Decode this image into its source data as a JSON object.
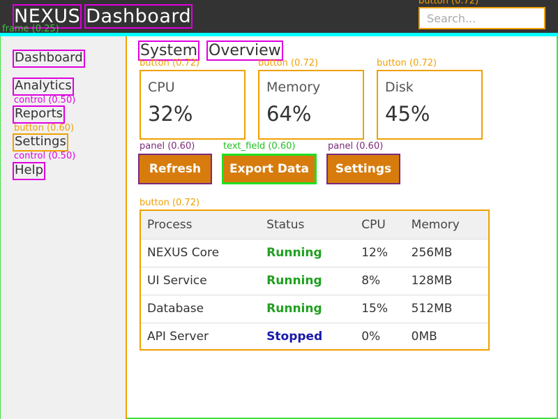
{
  "header": {
    "title_words": [
      "NEXUS",
      "Dashboard"
    ],
    "search_placeholder": "Search..."
  },
  "sidebar": {
    "items": [
      {
        "label": "Dashboard"
      },
      {
        "label": "Analytics"
      },
      {
        "label": "Reports"
      },
      {
        "label": "Settings"
      },
      {
        "label": "Help"
      }
    ]
  },
  "main": {
    "title_words": [
      "System",
      "Overview"
    ],
    "cards": [
      {
        "label": "CPU",
        "value": "32%"
      },
      {
        "label": "Memory",
        "value": "64%"
      },
      {
        "label": "Disk",
        "value": "45%"
      }
    ],
    "actions": {
      "refresh": "Refresh",
      "export": "Export Data",
      "settings": "Settings"
    },
    "table": {
      "headers": [
        "Process",
        "Status",
        "CPU",
        "Memory"
      ],
      "rows": [
        {
          "process": "NEXUS Core",
          "status": "Running",
          "cpu": "12%",
          "memory": "256MB"
        },
        {
          "process": "UI Service",
          "status": "Running",
          "cpu": "8%",
          "memory": "128MB"
        },
        {
          "process": "Database",
          "status": "Running",
          "cpu": "15%",
          "memory": "512MB"
        },
        {
          "process": "API Server",
          "status": "Stopped",
          "cpu": "0%",
          "memory": "0MB"
        }
      ]
    }
  },
  "overlay_labels": {
    "search": "button (0.72)",
    "cards": [
      "button (0.72)",
      "button (0.72)",
      "button (0.72)"
    ],
    "actions": [
      "panel (0.60)",
      "text_field (0.60)",
      "panel (0.60)"
    ],
    "table": "button (0.72)",
    "nav_settings": "button (0.60)",
    "nav_reports": "control (0.50)",
    "nav_help": "control (0.50)",
    "sidebar_frame": "frame (0.25)"
  },
  "colors": {
    "header_bg": "#333333",
    "accent": "#00ffff",
    "button_bg": "#d77c0c",
    "running": "#20a020",
    "stopped": "#1a1aa8",
    "detection_orange": "#f0a000",
    "detection_magenta": "#e000e0",
    "detection_green": "#40e040"
  }
}
